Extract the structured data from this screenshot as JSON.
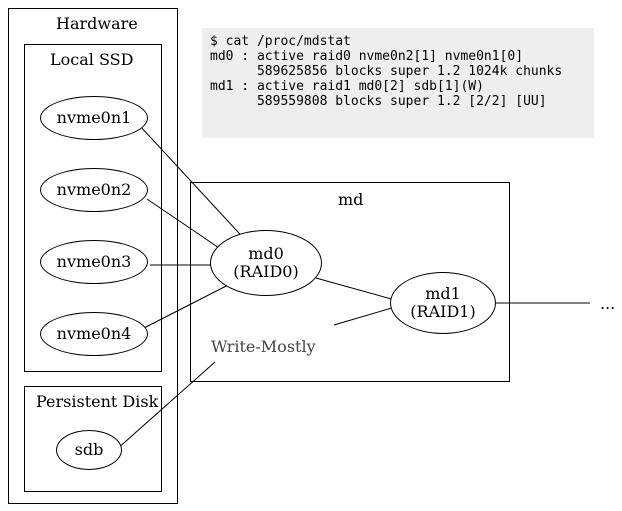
{
  "hardware": {
    "label": "Hardware"
  },
  "local_ssd": {
    "label": "Local SSD"
  },
  "persistent_disk": {
    "label": "Persistent Disk"
  },
  "disks": {
    "nvme0n1": "nvme0n1",
    "nvme0n2": "nvme0n2",
    "nvme0n3": "nvme0n3",
    "nvme0n4": "nvme0n4",
    "sdb": "sdb"
  },
  "md": {
    "label": "md",
    "md0": "md0\n(RAID0)",
    "md1": "md1\n(RAID1)"
  },
  "write_mostly": "Write-Mostly",
  "ellipsis": "...",
  "mdstat": {
    "line1": "$ cat /proc/mdstat",
    "line2": "md0 : active raid0 nvme0n2[1] nvme0n1[0]",
    "line3": "      589625856 blocks super 1.2 1024k chunks",
    "line4": "md1 : active raid1 md0[2] sdb[1](W)",
    "line5": "      589559808 blocks super 1.2 [2/2] [UU]"
  },
  "chart_data": {
    "type": "diagram",
    "title": "Linux md RAID layout",
    "nodes": [
      {
        "id": "nvme0n1",
        "group": "Local SSD"
      },
      {
        "id": "nvme0n2",
        "group": "Local SSD"
      },
      {
        "id": "nvme0n3",
        "group": "Local SSD"
      },
      {
        "id": "nvme0n4",
        "group": "Local SSD"
      },
      {
        "id": "sdb",
        "group": "Persistent Disk"
      },
      {
        "id": "md0",
        "label": "md0 (RAID0)",
        "group": "md"
      },
      {
        "id": "md1",
        "label": "md1 (RAID1)",
        "group": "md"
      }
    ],
    "edges": [
      {
        "from": "nvme0n1",
        "to": "md0"
      },
      {
        "from": "nvme0n2",
        "to": "md0"
      },
      {
        "from": "nvme0n3",
        "to": "md0"
      },
      {
        "from": "nvme0n4",
        "to": "md0"
      },
      {
        "from": "md0",
        "to": "md1"
      },
      {
        "from": "sdb",
        "to": "md1",
        "annotation": "Write-Mostly"
      },
      {
        "from": "md1",
        "to": "..."
      }
    ],
    "groups": [
      {
        "id": "Hardware",
        "contains": [
          "Local SSD",
          "Persistent Disk"
        ]
      },
      {
        "id": "Local SSD",
        "contains": [
          "nvme0n1",
          "nvme0n2",
          "nvme0n3",
          "nvme0n4"
        ]
      },
      {
        "id": "Persistent Disk",
        "contains": [
          "sdb"
        ]
      },
      {
        "id": "md",
        "contains": [
          "md0",
          "md1"
        ]
      }
    ]
  }
}
